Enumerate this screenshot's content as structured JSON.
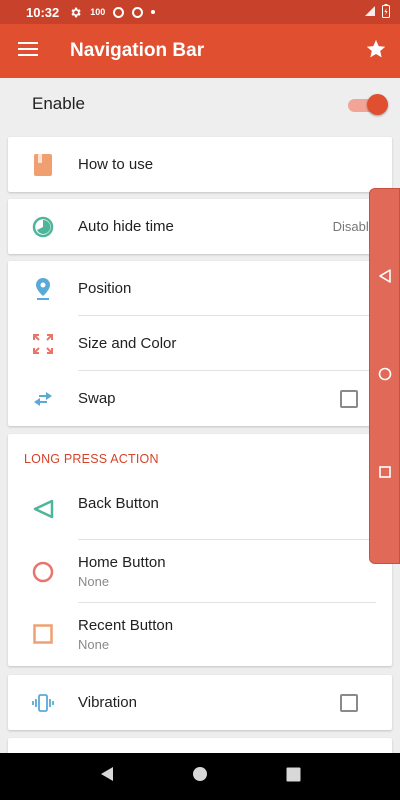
{
  "status_bar": {
    "time": "10:32",
    "indicator_100": "100"
  },
  "app_bar": {
    "title": "Navigation Bar"
  },
  "enable": {
    "label": "Enable",
    "on": true
  },
  "items": {
    "how_to_use": "How to use",
    "auto_hide_time": "Auto hide time",
    "auto_hide_value": "Disable",
    "position": "Position",
    "size_and_color": "Size and Color",
    "swap": "Swap"
  },
  "long_press": {
    "header": "LONG PRESS ACTION",
    "back_button": "Back Button",
    "home_button": "Home Button",
    "home_value": "None",
    "recent_button": "Recent Button",
    "recent_value": "None"
  },
  "vibration": {
    "label": "Vibration"
  },
  "colors": {
    "accent": "#e04f2f",
    "status_bar": "#c8412a",
    "panel": "#e06a57"
  },
  "icons": {
    "how_to_use": "book-icon",
    "auto_hide": "timer-icon",
    "position": "map-pin-icon",
    "size_and_color": "resize-icon",
    "swap": "swap-arrows-icon",
    "back": "triangle-back-icon",
    "home": "circle-home-icon",
    "recent": "square-recent-icon",
    "vibration": "vibration-icon"
  }
}
